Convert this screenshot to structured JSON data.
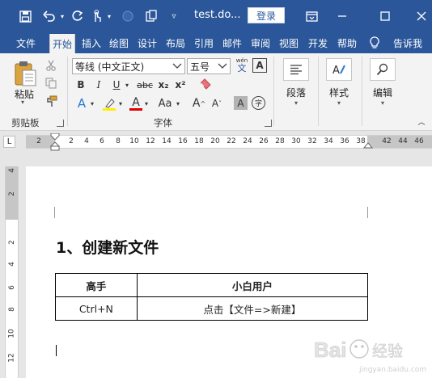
{
  "window": {
    "doc_title": "test.do...",
    "login_label": "登录",
    "colors": {
      "accent": "#2b579a",
      "ribbon_bg": "#f3f3f3",
      "canvas": "#e6e6e6"
    }
  },
  "quick_access": [
    "save-icon",
    "undo-icon",
    "redo-icon",
    "touch-mode-icon",
    "circle-icon",
    "clipboard-icon",
    "customize-icon"
  ],
  "tabs": [
    {
      "label": "文件"
    },
    {
      "label": "开始",
      "active": true
    },
    {
      "label": "插入"
    },
    {
      "label": "绘图"
    },
    {
      "label": "设计"
    },
    {
      "label": "布局"
    },
    {
      "label": "引用"
    },
    {
      "label": "邮件"
    },
    {
      "label": "审阅"
    },
    {
      "label": "视图"
    },
    {
      "label": "开发"
    },
    {
      "label": "帮助"
    },
    {
      "label": "告诉我"
    }
  ],
  "ribbon": {
    "clipboard": {
      "paste_label": "粘贴",
      "group_label": "剪贴板"
    },
    "font": {
      "font_name": "等线 (中文正文)",
      "font_size": "五号",
      "phonetic_top": "wén",
      "phonetic_bottom": "文",
      "group_label": "字体",
      "buttons": [
        "B",
        "I",
        "U",
        "abc",
        "x₂",
        "x²",
        "Aa"
      ]
    },
    "paragraph": {
      "label": "段落"
    },
    "styles": {
      "label": "样式"
    },
    "editing": {
      "label": "编辑"
    }
  },
  "ruler": {
    "ticks": [
      "2",
      "2",
      "4",
      "6",
      "8",
      "10",
      "12",
      "14",
      "16",
      "18",
      "20",
      "22",
      "24",
      "26",
      "28",
      "30",
      "32",
      "34",
      "36",
      "38",
      "42",
      "44",
      "46"
    ],
    "corner": "L",
    "vticks": [
      "4",
      "2",
      "2",
      "4",
      "6",
      "8",
      "10",
      "12"
    ]
  },
  "document": {
    "heading": "1、创建新文件",
    "table": {
      "headers": [
        "高手",
        "小白用户"
      ],
      "rows": [
        [
          "Ctrl+N",
          "点击【文件=>新建】"
        ]
      ]
    }
  },
  "watermark": {
    "text": "Bai 经验",
    "sub": "jingyan.baidu.com"
  }
}
